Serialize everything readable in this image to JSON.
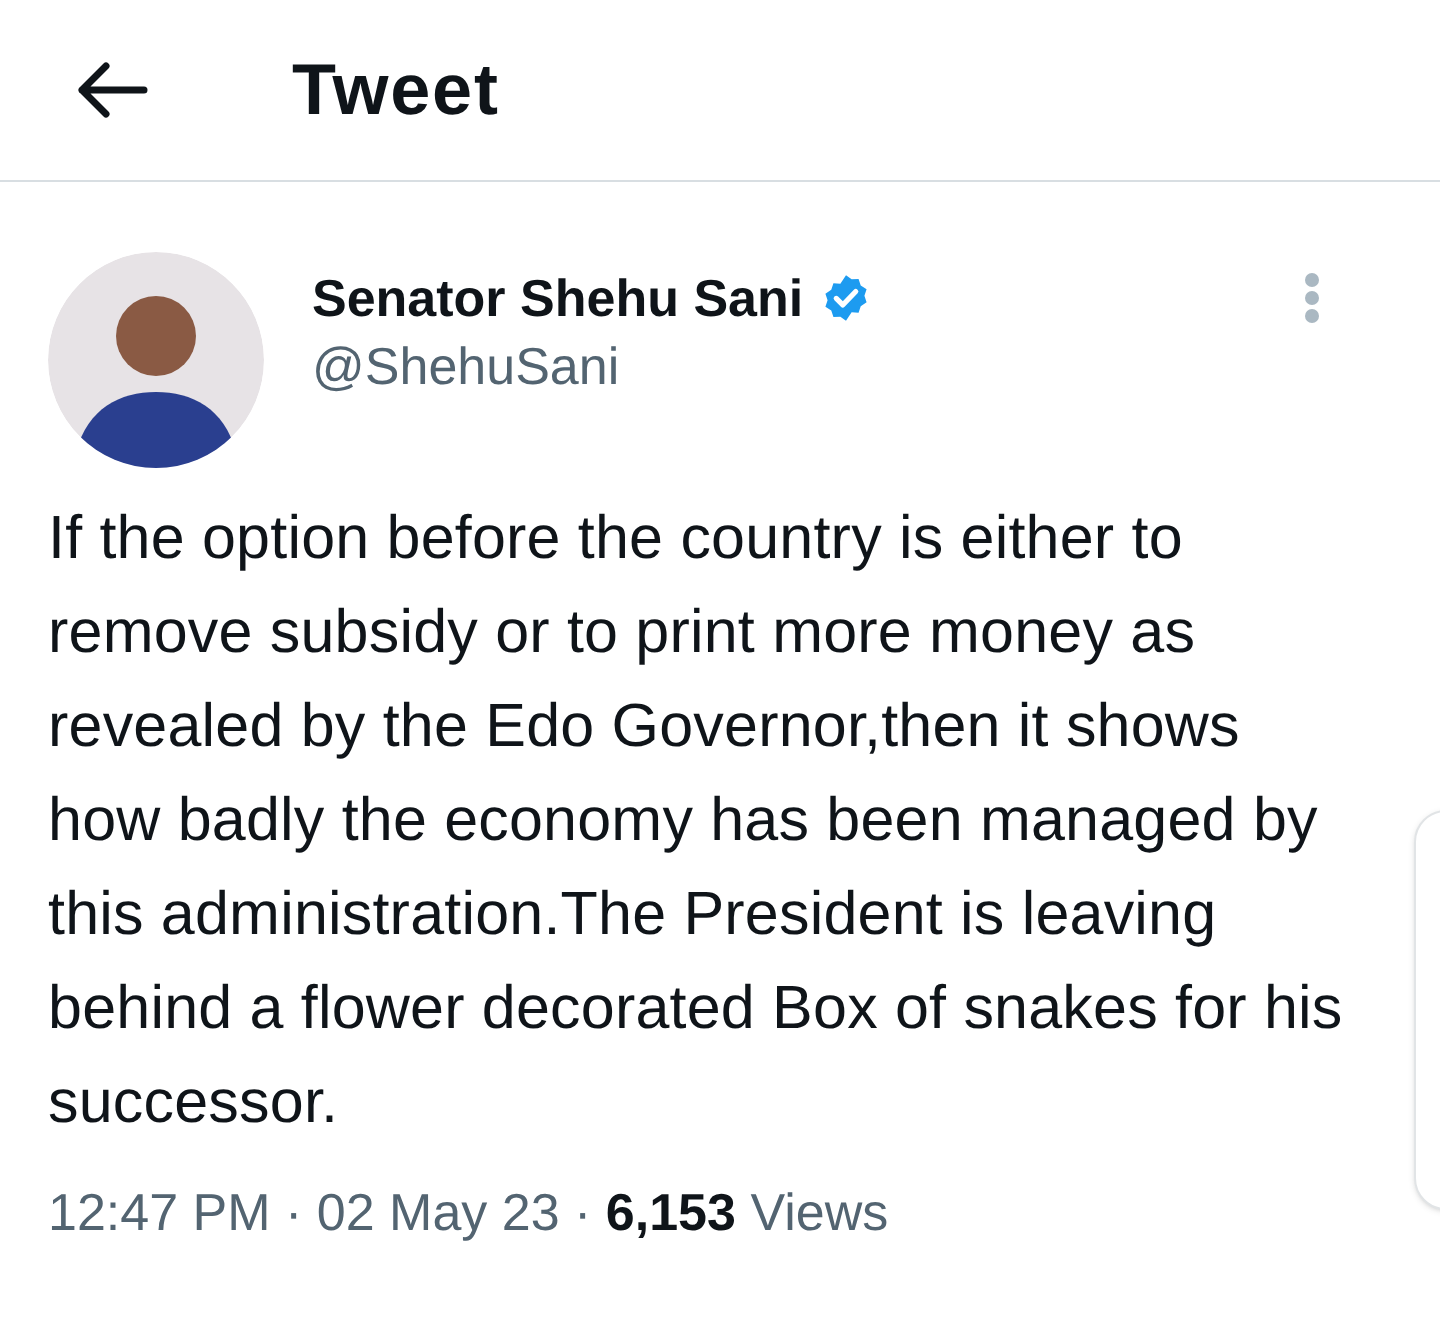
{
  "header": {
    "title": "Tweet"
  },
  "author": {
    "name": "Senator Shehu Sani",
    "verified": true,
    "handle": "@ShehuSani"
  },
  "text": "If the option before the country is either to remove subsidy or to print more money as revealed by the Edo Governor,then it shows how badly the economy has been managed by this administration.The President is leaving behind a flower decorated Box of snakes for his successor.",
  "meta": "12:47 PM · 02 May 23 · **6,153** Views"
}
